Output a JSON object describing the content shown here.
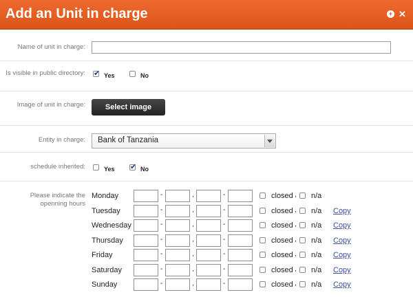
{
  "dialog": {
    "title": "Add an Unit in charge",
    "add_icon": "plus-circle-icon",
    "close_icon": "close-icon"
  },
  "form": {
    "name_label": "Name of unit in charge:",
    "name_value": "",
    "visible_label": "Is visible in public directory:",
    "visible_yes": "Yes",
    "visible_no": "No",
    "visible_selected": "Yes",
    "image_label": "Image of unit in charge:",
    "select_image": "Select image",
    "entity_label": "Entity in charge:",
    "entity_value": "Bank of Tanzania",
    "schedule_label": "schedule inherited:",
    "schedule_yes": "Yes",
    "schedule_no": "No",
    "schedule_selected": "No",
    "hours_label": "Please indicate the openning hours"
  },
  "hours": {
    "closed_label": "closed",
    "na_label": "n/a",
    "copy_label": "Copy",
    "days": [
      {
        "day": "Monday"
      },
      {
        "day": "Tuesday"
      },
      {
        "day": "Wednesday"
      },
      {
        "day": "Thursday"
      },
      {
        "day": "Friday"
      },
      {
        "day": "Saturday"
      },
      {
        "day": "Sunday"
      }
    ]
  },
  "colors": {
    "title_bar": "#dc5417",
    "button_bg": "#2e2e2e",
    "link": "#3b4fa0"
  }
}
